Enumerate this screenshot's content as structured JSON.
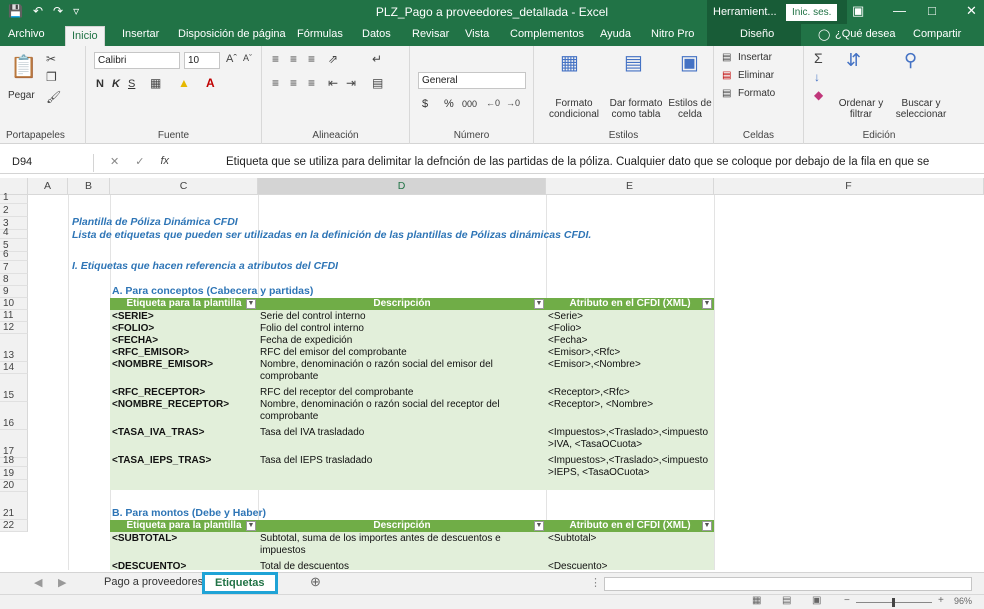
{
  "title": "PLZ_Pago a proveedores_detallada - Excel",
  "context_tool": "Herramient...",
  "signin": "Inic. ses.",
  "tabs": [
    "Archivo",
    "Inicio",
    "Insertar",
    "Disposición de página",
    "Fórmulas",
    "Datos",
    "Revisar",
    "Vista",
    "Complementos",
    "Ayuda",
    "Nitro Pro",
    "Diseño"
  ],
  "tell_me": "¿Qué desea",
  "share": "Compartir",
  "ribbon": {
    "pegar": "Pegar",
    "portapapeles": "Portapapeles",
    "font_name": "Calibri",
    "font_size": "10",
    "fuente": "Fuente",
    "alineacion": "Alineación",
    "number_format": "General",
    "numero": "Número",
    "formato_condicional": "Formato condicional",
    "dar_formato": "Dar formato como tabla",
    "estilos_celda": "Estilos de celda",
    "estilos": "Estilos",
    "insertar": "Insertar",
    "eliminar": "Eliminar",
    "formato": "Formato",
    "celdas": "Celdas",
    "ordenar": "Ordenar y filtrar",
    "buscar": "Buscar y seleccionar",
    "edicion": "Edición",
    "bold": "N",
    "italic": "K",
    "underline": "S",
    "currency": "$",
    "percent": "%",
    "thousands": "000"
  },
  "formula_bar": {
    "name_box": "D94",
    "fx": "fx",
    "value": "Etiqueta que se utiliza para delimitar la defnción de las partidas de la póliza. Cualquier dato que se coloque por debajo de la fila en que se"
  },
  "columns": [
    "A",
    "B",
    "C",
    "D",
    "E",
    "F"
  ],
  "rows": [
    "1",
    "2",
    "3",
    "4",
    "5",
    "6",
    "7",
    "8",
    "9",
    "10",
    "11",
    "12",
    "13",
    "14",
    "15",
    "16",
    "17",
    "18",
    "19",
    "20",
    "21",
    "22"
  ],
  "content": {
    "title": "Plantilla de Póliza Dinámica CFDI",
    "subtitle": "Lista de etiquetas que pueden ser utilizadas en la definición de las plantillas de Pólizas dinámicas CFDI.",
    "section1": "I. Etiquetas que hacen referencia a atributos del CFDI",
    "subsectionA": "A. Para conceptos (Cabecera y partidas)",
    "subsectionB": "B. Para montos (Debe y Haber)",
    "headers": [
      "Etiqueta para la plantilla",
      "Descripción",
      "Atributo en el CFDI (XML)"
    ],
    "tableA": [
      [
        "<SERIE>",
        "Serie del control interno",
        "<Serie>"
      ],
      [
        "<FOLIO>",
        "Folio del control interno",
        "<Folio>"
      ],
      [
        "<FECHA>",
        "Fecha de expedición",
        "<Fecha>"
      ],
      [
        "<RFC_EMISOR>",
        "RFC del emisor del comprobante",
        "<Emisor>,<Rfc>"
      ],
      [
        "<NOMBRE_EMISOR>",
        "Nombre, denominación  o razón social del emisor del comprobante",
        "<Emisor>,<Nombre>"
      ],
      [
        "<RFC_RECEPTOR>",
        "RFC del receptor del comprobante",
        "<Receptor>,<Rfc>"
      ],
      [
        "<NOMBRE_RECEPTOR>",
        "Nombre, denominación  o razón social del receptor del comprobante",
        "<Receptor>, <Nombre>"
      ],
      [
        "<TASA_IVA_TRAS>",
        "Tasa del IVA trasladado",
        "<Impuestos>,<Traslado>,<impuesto >IVA, <TasaOCuota>"
      ],
      [
        "<TASA_IEPS_TRAS>",
        "Tasa del IEPS trasladado",
        "<Impuestos>,<Traslado>,<impuesto >IEPS, <TasaOCuota>"
      ]
    ],
    "tableB": [
      [
        "<SUBTOTAL>",
        "Subtotal, suma de los importes antes de descuentos e impuestos",
        "<Subtotal>"
      ],
      [
        "<DESCUENTO>",
        "Total de descuentos",
        "<Descuento>"
      ]
    ]
  },
  "sheets": [
    "Pago a proveedores",
    "Etiquetas"
  ],
  "zoom": "96%"
}
